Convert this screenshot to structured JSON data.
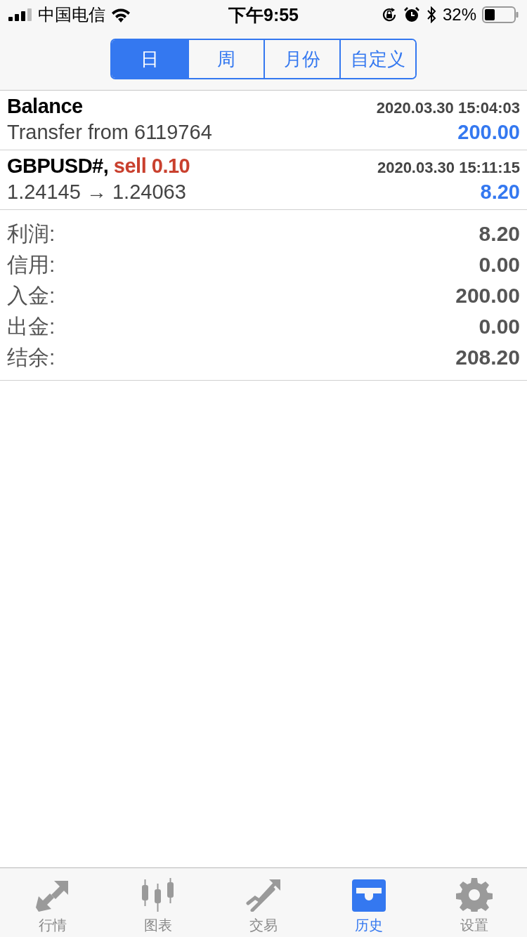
{
  "status_bar": {
    "carrier": "中国电信",
    "time": "下午9:55",
    "battery": "32%"
  },
  "tabs": [
    {
      "label": "日",
      "selected": true
    },
    {
      "label": "周",
      "selected": false
    },
    {
      "label": "月份",
      "selected": false
    },
    {
      "label": "自定义",
      "selected": false
    }
  ],
  "deals": [
    {
      "title": "Balance",
      "time": "2020.03.30 15:04:03",
      "detail": "Transfer from 6119764",
      "profit": "200.00"
    },
    {
      "title": "GBPUSD#,",
      "action": "sell 0.10",
      "time": "2020.03.30 15:11:15",
      "detail": "1.24145 → 1.24063",
      "profit": "8.20"
    }
  ],
  "summary": [
    {
      "label": "利润:",
      "value": "8.20"
    },
    {
      "label": "信用:",
      "value": "0.00"
    },
    {
      "label": "入金:",
      "value": "200.00"
    },
    {
      "label": "出金:",
      "value": "0.00"
    },
    {
      "label": "结余:",
      "value": "208.20"
    }
  ],
  "nav": [
    {
      "kind": "quotes",
      "label": "行情",
      "selected": false
    },
    {
      "kind": "chart",
      "label": "图表",
      "selected": false
    },
    {
      "kind": "trade",
      "label": "交易",
      "selected": false
    },
    {
      "kind": "history",
      "label": "历史",
      "selected": true
    },
    {
      "kind": "settings",
      "label": "设置",
      "selected": false
    }
  ]
}
